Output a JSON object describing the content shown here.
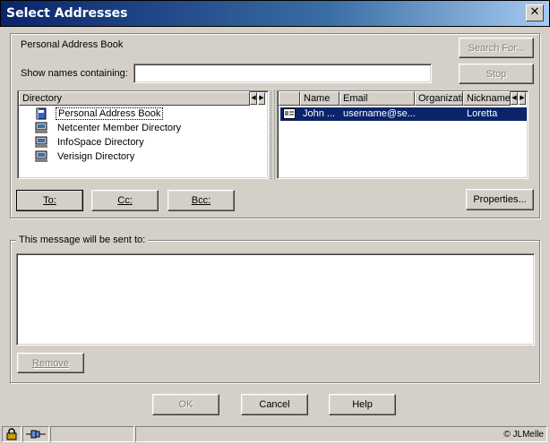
{
  "window": {
    "title": "Select Addresses",
    "close_glyph": "✕"
  },
  "top": {
    "book_label": "Personal Address Book",
    "search_label": "Search For...",
    "show_names_label": "Show names containing:",
    "show_names_value": "",
    "stop_label": "Stop"
  },
  "directory": {
    "header": "Directory",
    "items": [
      {
        "label": "Personal Address Book",
        "icon": "address-book-icon"
      },
      {
        "label": "Netcenter Member Directory",
        "icon": "network-directory-icon"
      },
      {
        "label": "InfoSpace Directory",
        "icon": "network-directory-icon"
      },
      {
        "label": "Verisign Directory",
        "icon": "network-directory-icon"
      }
    ]
  },
  "results": {
    "columns": [
      "Name",
      "Email",
      "Organizati",
      "Nickname"
    ],
    "rows": [
      {
        "name": "John ...",
        "email": "username@se...",
        "organization": "",
        "nickname": "Loretta",
        "icon": "contact-card-icon"
      }
    ]
  },
  "recipient_buttons": {
    "to": "To:",
    "cc": "Cc:",
    "bcc": "Bcc:"
  },
  "properties_label": "Properties...",
  "sent_to": {
    "label": "This message will be sent to:",
    "remove_label": "Remove"
  },
  "footer": {
    "ok": "OK",
    "cancel": "Cancel",
    "help": "Help"
  },
  "status": {
    "credit": "© JLMelle"
  },
  "colors": {
    "title_start": "#0a246a",
    "title_end": "#a6caf0",
    "selection": "#0a246a",
    "face": "#d4d0c8"
  }
}
